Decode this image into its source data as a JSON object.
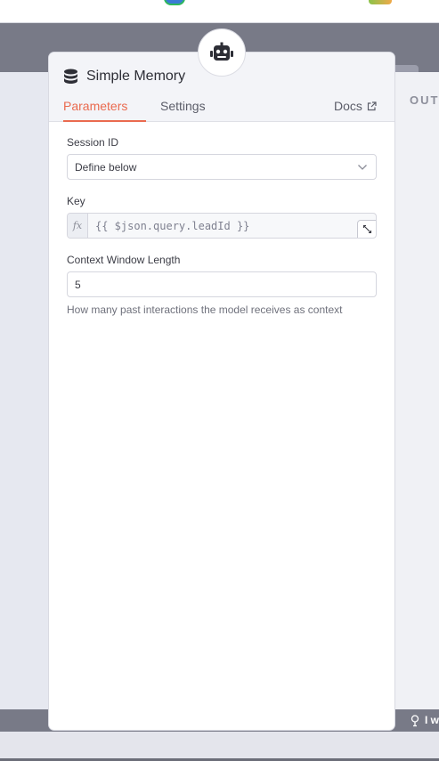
{
  "window": {
    "output_label": "OUT",
    "tip_text": "I w"
  },
  "panel": {
    "node_icon": "robot-icon",
    "title": "Simple Memory",
    "title_icon": "database-icon",
    "tabs": [
      {
        "label": "Parameters",
        "active": true
      },
      {
        "label": "Settings",
        "active": false
      }
    ],
    "docs_label": "Docs",
    "accent_color": "#ea6a4f"
  },
  "fields": {
    "session_id": {
      "label": "Session ID",
      "value": "Define below"
    },
    "key": {
      "label": "Key",
      "fx": "fx",
      "value": "{{ $json.query.leadId }}"
    },
    "context_window": {
      "label": "Context Window Length",
      "value": "5",
      "hint": "How many past interactions the model receives as context"
    }
  }
}
